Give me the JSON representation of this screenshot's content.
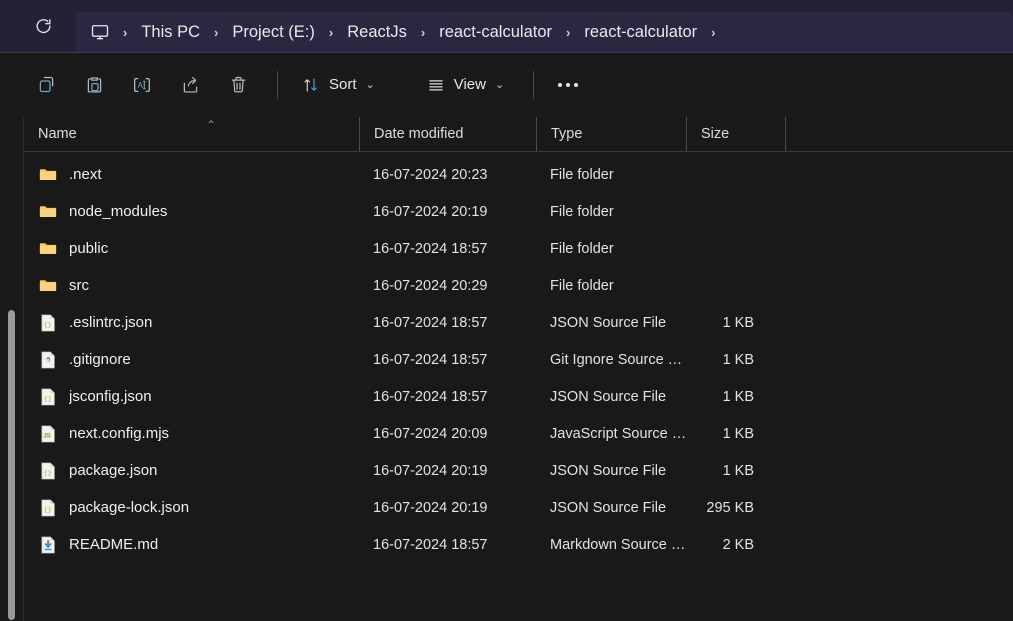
{
  "addressbar": {
    "refresh_icon": "refresh-icon",
    "device_icon": "monitor-icon",
    "separator": "›",
    "crumbs": [
      {
        "label": "This PC"
      },
      {
        "label": "Project (E:)"
      },
      {
        "label": "ReactJs"
      },
      {
        "label": "react-calculator"
      },
      {
        "label": "react-calculator"
      }
    ]
  },
  "toolbar": {
    "icons": [
      {
        "name": "copy-icon"
      },
      {
        "name": "paste-icon"
      },
      {
        "name": "rename-icon"
      },
      {
        "name": "share-icon"
      },
      {
        "name": "delete-icon"
      }
    ],
    "sort_label": "Sort",
    "sort_icon": "sort-arrows-icon",
    "view_label": "View",
    "view_icon": "view-list-icon",
    "chevron": "⌄",
    "overflow_icon": "more-options-icon"
  },
  "columns": {
    "name": "Name",
    "date_modified": "Date modified",
    "type": "Type",
    "size": "Size",
    "sort_caret": "⌃"
  },
  "files": [
    {
      "name": ".next",
      "date": "16-07-2024 20:23",
      "type": "File folder",
      "size": "",
      "icon": "folder-icon"
    },
    {
      "name": "node_modules",
      "date": "16-07-2024 20:19",
      "type": "File folder",
      "size": "",
      "icon": "folder-icon"
    },
    {
      "name": "public",
      "date": "16-07-2024 18:57",
      "type": "File folder",
      "size": "",
      "icon": "folder-icon"
    },
    {
      "name": "src",
      "date": "16-07-2024 20:29",
      "type": "File folder",
      "size": "",
      "icon": "folder-icon"
    },
    {
      "name": ".eslintrc.json",
      "date": "16-07-2024 18:57",
      "type": "JSON Source File",
      "size": "1 KB",
      "icon": "json-file-icon"
    },
    {
      "name": ".gitignore",
      "date": "16-07-2024 18:57",
      "type": "Git Ignore Source …",
      "size": "1 KB",
      "icon": "gitignore-file-icon"
    },
    {
      "name": "jsconfig.json",
      "date": "16-07-2024 18:57",
      "type": "JSON Source File",
      "size": "1 KB",
      "icon": "json-file-icon"
    },
    {
      "name": "next.config.mjs",
      "date": "16-07-2024 20:09",
      "type": "JavaScript Source …",
      "size": "1 KB",
      "icon": "js-file-icon"
    },
    {
      "name": "package.json",
      "date": "16-07-2024 20:19",
      "type": "JSON Source File",
      "size": "1 KB",
      "icon": "json-file-icon"
    },
    {
      "name": "package-lock.json",
      "date": "16-07-2024 20:19",
      "type": "JSON Source File",
      "size": "295 KB",
      "icon": "json-file-icon"
    },
    {
      "name": "README.md",
      "date": "16-07-2024 18:57",
      "type": "Markdown Source …",
      "size": "2 KB",
      "icon": "markdown-file-icon"
    }
  ],
  "colors": {
    "addressbar_bg": "#232136",
    "toolbar_bg": "#1a1a1a",
    "content_bg": "#191919",
    "folder_yellow": "#f7c860",
    "json_glyph": "#c9c34a",
    "js_glyph": "#8a9a30",
    "markdown_blue": "#4a8fc0",
    "scrollbar_thumb": "#9a9a9a"
  }
}
